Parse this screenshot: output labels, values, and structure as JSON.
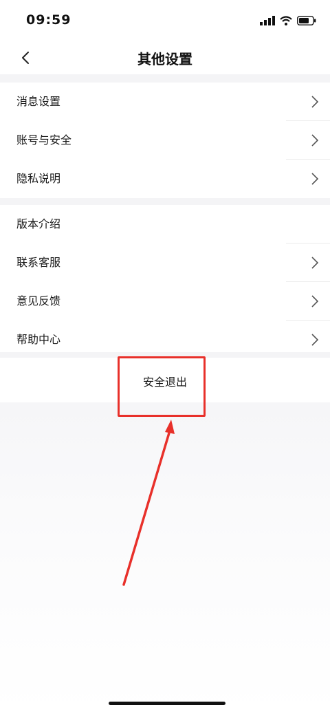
{
  "status_bar": {
    "time": "09:59",
    "icons": [
      "signal-icon",
      "wifi-icon",
      "battery-icon"
    ]
  },
  "nav": {
    "title": "其他设置",
    "back_icon": "chevron-left-icon"
  },
  "group1": [
    {
      "label": "消息设置",
      "has_arrow": true
    },
    {
      "label": "账号与安全",
      "has_arrow": true
    },
    {
      "label": "隐私说明",
      "has_arrow": true
    }
  ],
  "group2": [
    {
      "label": "版本介绍",
      "has_arrow": false
    },
    {
      "label": "联系客服",
      "has_arrow": true
    },
    {
      "label": "意见反馈",
      "has_arrow": true
    },
    {
      "label": "帮助中心",
      "has_arrow": true
    }
  ],
  "logout": {
    "label": "安全退出"
  },
  "annotation": {
    "color": "#e8302a"
  }
}
